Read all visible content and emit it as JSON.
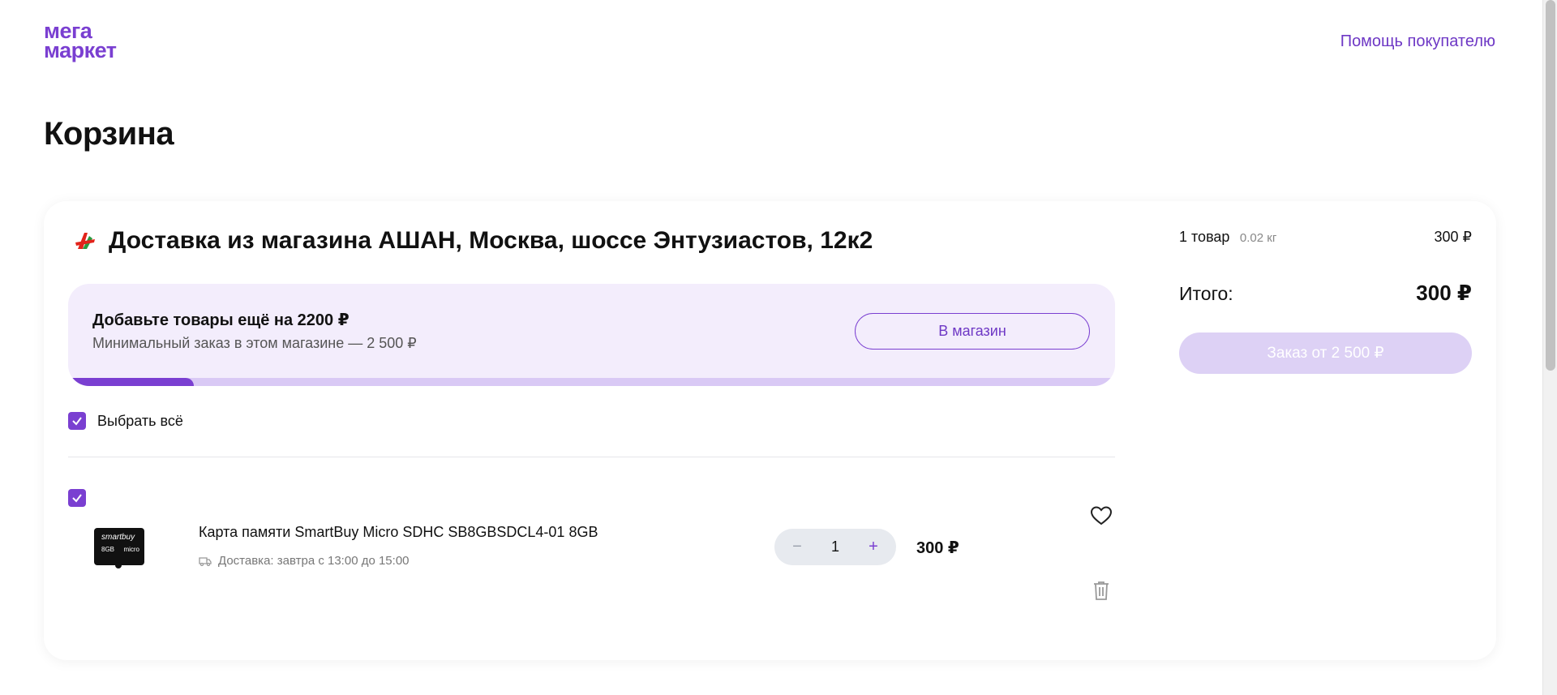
{
  "header": {
    "logo_line1": "мега",
    "logo_line2": "маркет",
    "help_link": "Помощь покупателю"
  },
  "page": {
    "title": "Корзина"
  },
  "store": {
    "title": "Доставка из магазина АШАН, Москва, шоссе Энтузиастов, 12к2",
    "logo_icon": "auchan-logo-icon"
  },
  "promo": {
    "title": "Добавьте товары ещё на 2200 ₽",
    "subtitle": "Минимальный заказ в этом магазине — 2 500 ₽",
    "button": "В магазин",
    "progress": 0.12
  },
  "select_all": {
    "label": "Выбрать всё",
    "checked": true
  },
  "items": [
    {
      "name": "Карта памяти SmartBuy Micro SDHC SB8GBSDCL4-01 8GB",
      "delivery": "Доставка: завтра с 13:00 до 15:00",
      "quantity": "1",
      "price": "300 ₽",
      "checked": true,
      "image_text": {
        "brand": "smartbuy",
        "capacity": "8GB",
        "type": "micro"
      }
    }
  ],
  "summary": {
    "count": "1 товар",
    "weight": "0.02 кг",
    "subtotal": "300 ₽",
    "total_label": "Итого:",
    "total_value": "300 ₽",
    "order_button": "Заказ от 2 500 ₽"
  },
  "colors": {
    "accent": "#7a3fd1",
    "promo_bg": "#f3edfc",
    "order_btn_disabled": "#ddd1f5"
  }
}
